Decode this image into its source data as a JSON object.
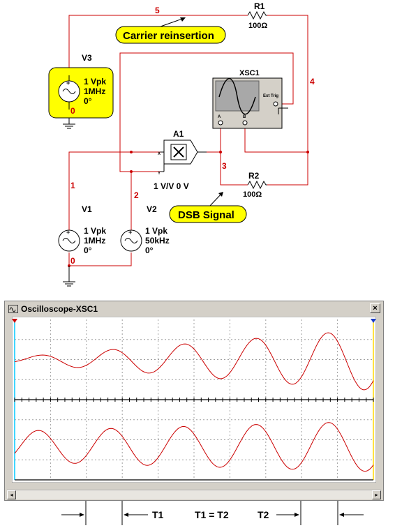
{
  "labels": {
    "carrier_callout": "Carrier reinsertion",
    "dsb_callout": "DSB Signal",
    "r1_name": "R1",
    "r1_value": "100Ω",
    "r2_name": "R2",
    "r2_value": "100Ω",
    "v3_name": "V3",
    "v3_amp": "1 Vpk",
    "v3_freq": "1MHz",
    "v3_phase": "0°",
    "v1_name": "V1",
    "v1_amp": "1 Vpk",
    "v1_freq": "1MHz",
    "v1_phase": "0°",
    "v2_name": "V2",
    "v2_amp": "1 Vpk",
    "v2_freq": "50kHz",
    "v2_phase": "0°",
    "a1_name": "A1",
    "a1_gain": "1 V/V 0 V",
    "a1_in_x": "X",
    "a1_in_y": "Y",
    "xsc_name": "XSC1",
    "xsc_ext": "Ext Trig",
    "xsc_a": "A",
    "xsc_b": "B",
    "node5": "5",
    "node4": "4",
    "node3": "3",
    "node2": "2",
    "node1": "1",
    "node0_top": "0",
    "node0_bottom": "0"
  },
  "scope": {
    "title": "Oscilloscope-XSC1",
    "close": "×"
  },
  "annotations": {
    "t1": "T1",
    "eq": "T1 = T2",
    "t2": "T2"
  },
  "colors": {
    "wire": "#cc0000",
    "callout": "#ffff00",
    "trace": "#cc0000",
    "grid": "#a0a0a0"
  }
}
